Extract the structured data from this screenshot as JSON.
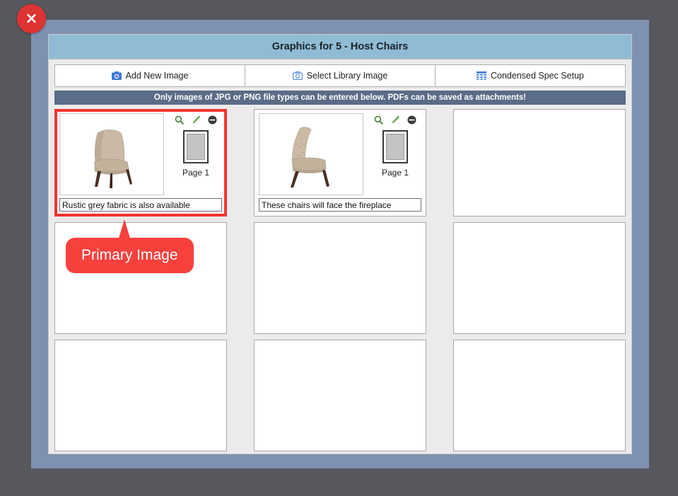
{
  "window": {
    "close_label": "×",
    "overlay_color": "#56585c",
    "frame_color": "#7f91b2",
    "body_color": "#ebebeb"
  },
  "header": {
    "title": "Graphics for 5 - Host Chairs",
    "background": "#8fbcd4"
  },
  "toolbar": {
    "buttons": [
      {
        "label": "Add New Image",
        "icon": "camera-filled-icon"
      },
      {
        "label": "Select Library Image",
        "icon": "camera-outline-icon"
      },
      {
        "label": "Condensed Spec Setup",
        "icon": "grid-table-icon"
      }
    ]
  },
  "info_banner": {
    "text": "Only images of JPG or PNG file types can be entered below. PDFs can be saved as attachments!",
    "background": "#5a6c86"
  },
  "annotation": {
    "primary_image_label": "Primary Image",
    "color": "#f8403c"
  },
  "grid": {
    "columns": 3,
    "rows": 3,
    "cards": [
      {
        "filled": true,
        "primary": true,
        "caption": "Rustic grey fabric is also available",
        "page_label": "Page 1",
        "image_alt": "host-chair-front-angle",
        "icons": [
          "magnifier-icon",
          "pencil-icon",
          "remove-circle-icon"
        ]
      },
      {
        "filled": true,
        "primary": false,
        "caption": "These chairs will face the fireplace",
        "page_label": "Page 1",
        "image_alt": "host-chair-side-profile",
        "icons": [
          "magnifier-icon",
          "pencil-icon",
          "remove-circle-icon"
        ]
      },
      {
        "filled": false
      },
      {
        "filled": false
      },
      {
        "filled": false
      },
      {
        "filled": false
      },
      {
        "filled": false
      },
      {
        "filled": false
      },
      {
        "filled": false
      }
    ]
  },
  "colors": {
    "primary_highlight": "#f4332f",
    "icon_green": "#3c7a2a",
    "icon_dark": "#3a3a3a",
    "toolbar_icon_blue": "#3f78d8"
  }
}
